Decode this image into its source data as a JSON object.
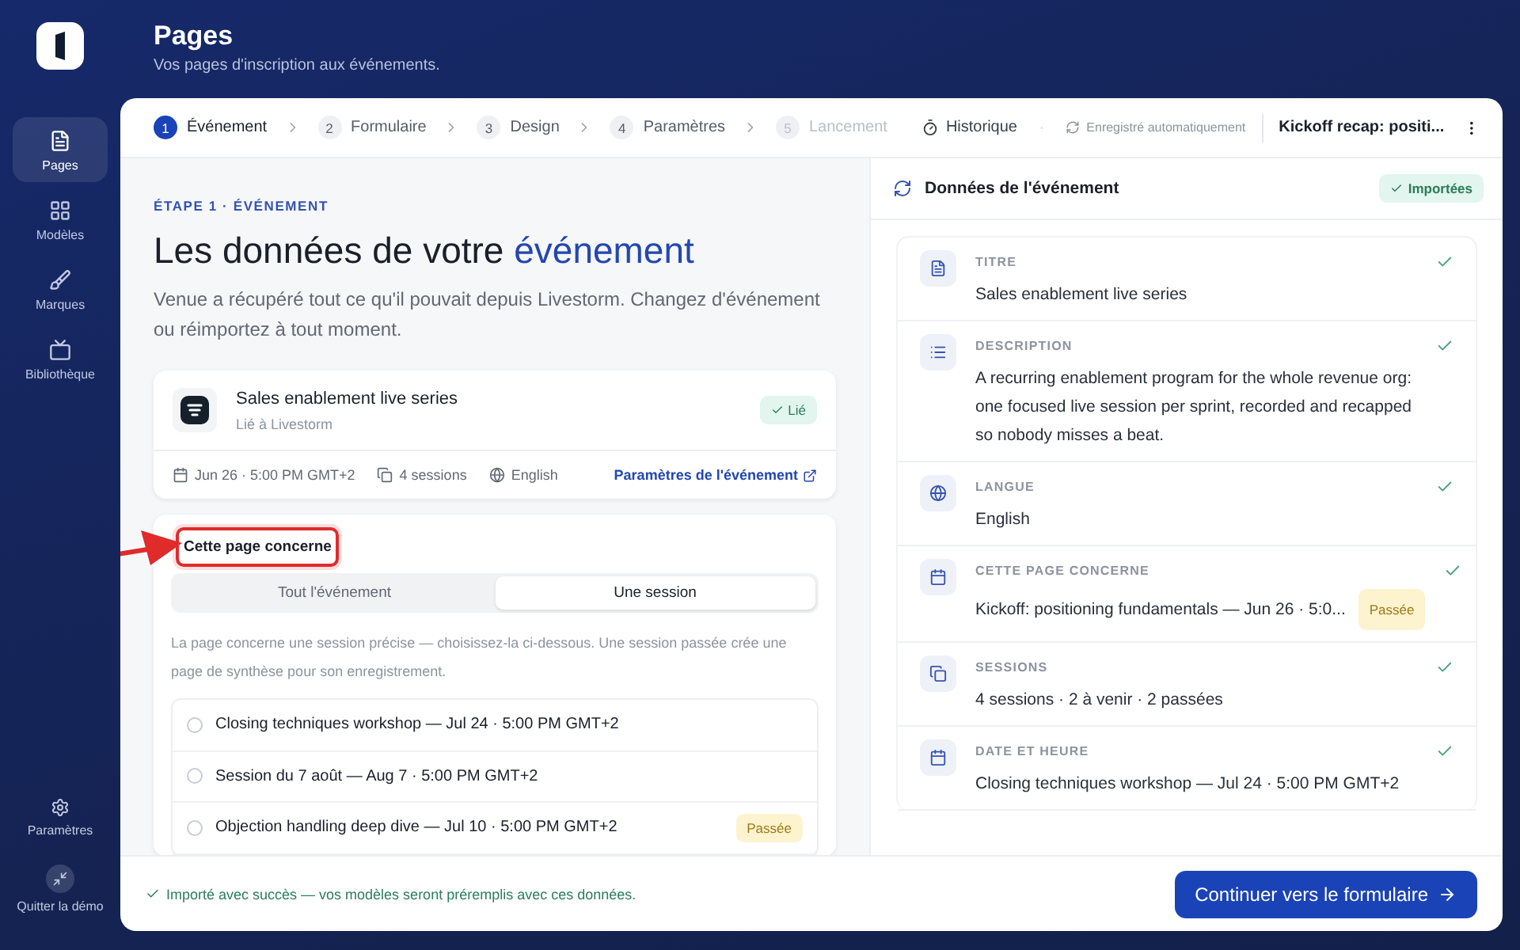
{
  "sidebar": {
    "items": [
      {
        "label": "Pages",
        "kind": "page",
        "selected": true
      },
      {
        "label": "Modèles",
        "kind": "grid",
        "selected": false
      },
      {
        "label": "Marques",
        "kind": "brush",
        "selected": false
      },
      {
        "label": "Bibliothèque",
        "kind": "tv",
        "selected": false
      }
    ],
    "bottom_items": [
      {
        "label": "Paramètres",
        "kind": "gear"
      },
      {
        "label": "Quitter la démo",
        "kind": "exit"
      }
    ]
  },
  "header": {
    "title": "Pages",
    "subtitle": "Vos pages d'inscription aux événements."
  },
  "stepper": {
    "steps": [
      {
        "number": "1",
        "label": "Événement",
        "selected": true,
        "disabled": false
      },
      {
        "number": "2",
        "label": "Formulaire",
        "selected": false,
        "disabled": false
      },
      {
        "number": "3",
        "label": "Design",
        "selected": false,
        "disabled": false
      },
      {
        "number": "4",
        "label": "Paramètres",
        "selected": false,
        "disabled": false
      },
      {
        "number": "5",
        "label": "Lancement",
        "selected": false,
        "disabled": true
      }
    ],
    "history": "Historique",
    "separator": "·",
    "autosave": "Enregistré automatiquement",
    "page_name": "Kickoff recap: positi..."
  },
  "left": {
    "eyebrow": "ÉTAPE 1 · ÉVÉNEMENT",
    "heading": "Les données de votre",
    "heading_accent": "événement",
    "intro": "Venue a récupéré tout ce qu'il pouvait depuis Livestorm. Changez d'événement ou réimportez à tout moment.",
    "event_card": {
      "title": "Sales enablement live series",
      "subtitle": "Lié à Livestorm",
      "badge": "Lié",
      "meta": [
        {
          "kind": "calendar",
          "text": "Jun 26 · 5:00 PM GMT+2"
        },
        {
          "kind": "copy",
          "text": "4 sessions"
        },
        {
          "kind": "globe",
          "text": "English"
        }
      ],
      "link": "Paramètres de l'événement"
    },
    "scope": {
      "label": "Cette page concerne",
      "options": [
        {
          "label": "Tout l'événement",
          "selected": false
        },
        {
          "label": "Une session",
          "selected": true
        }
      ],
      "help": "La page concerne une session précise — choisissez-la ci-dessous. Une session passée crée une page de synthèse pour son enregistrement.",
      "sessions": [
        {
          "label": "Closing techniques workshop — Jul 24 · 5:00 PM GMT+2",
          "selected": false
        },
        {
          "label": "Session du 7 août — Aug 7 · 5:00 PM GMT+2",
          "selected": false
        },
        {
          "label": "Objection handling deep dive — Jul 10 · 5:00 PM GMT+2",
          "selected": false,
          "badge": "Passée"
        }
      ]
    }
  },
  "right": {
    "title": "Données de l'événement",
    "badge": "Importées",
    "fields": [
      {
        "kind": "document",
        "label": "TITRE",
        "value": "Sales enablement live series",
        "checked": true
      },
      {
        "kind": "list",
        "label": "DESCRIPTION",
        "value": "A recurring enablement program for the whole revenue org: one focused live session per sprint, recorded and recapped so nobody misses a beat.",
        "checked": true
      },
      {
        "kind": "globe",
        "label": "LANGUE",
        "value": "English",
        "checked": true
      },
      {
        "kind": "calendar",
        "label": "CETTE PAGE CONCERNE",
        "value": "Kickoff: positioning fundamentals — Jun 26 · 5:0...",
        "badge": "Passée",
        "checked": true
      },
      {
        "kind": "copy",
        "label": "SESSIONS",
        "value": "4 sessions · 2 à venir · 2 passées",
        "checked": true
      },
      {
        "kind": "calendar",
        "label": "DATE ET HEURE",
        "value": "Closing techniques workshop — Jul 24 · 5:00 PM GMT+2",
        "checked": true
      }
    ]
  },
  "footer": {
    "message": "Importé avec succès — vos modèles seront préremplis avec ces données.",
    "button": "Continuer vers le formulaire"
  }
}
